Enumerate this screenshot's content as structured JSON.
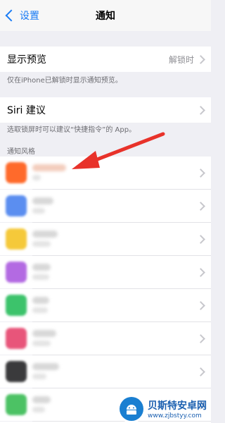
{
  "nav": {
    "back_label": "设置",
    "title": "通知"
  },
  "show_preview": {
    "label": "显示预览",
    "value": "解锁时"
  },
  "show_preview_note": "仅在iPhone已解锁时显示通知预览。",
  "siri": {
    "label": "Siri 建议"
  },
  "siri_note": "选取锁屏时可以建议“快捷指令”的 App。",
  "notification_style_header": "通知风格",
  "apps": [
    {
      "icon_color": "#ff6a2b"
    },
    {
      "icon_color": "#5b8ef0"
    },
    {
      "icon_color": "#f5c93a"
    },
    {
      "icon_color": "#b36ae2"
    },
    {
      "icon_color": "#3cc36b"
    },
    {
      "icon_color": "#e8557a"
    },
    {
      "icon_color": "#3a3a3c"
    },
    {
      "icon_color": "#4cc264"
    },
    {
      "icon_color": "#39c36a"
    }
  ],
  "watermark": {
    "title": "贝斯特安卓网",
    "url": "www.zjbstyy.com"
  }
}
